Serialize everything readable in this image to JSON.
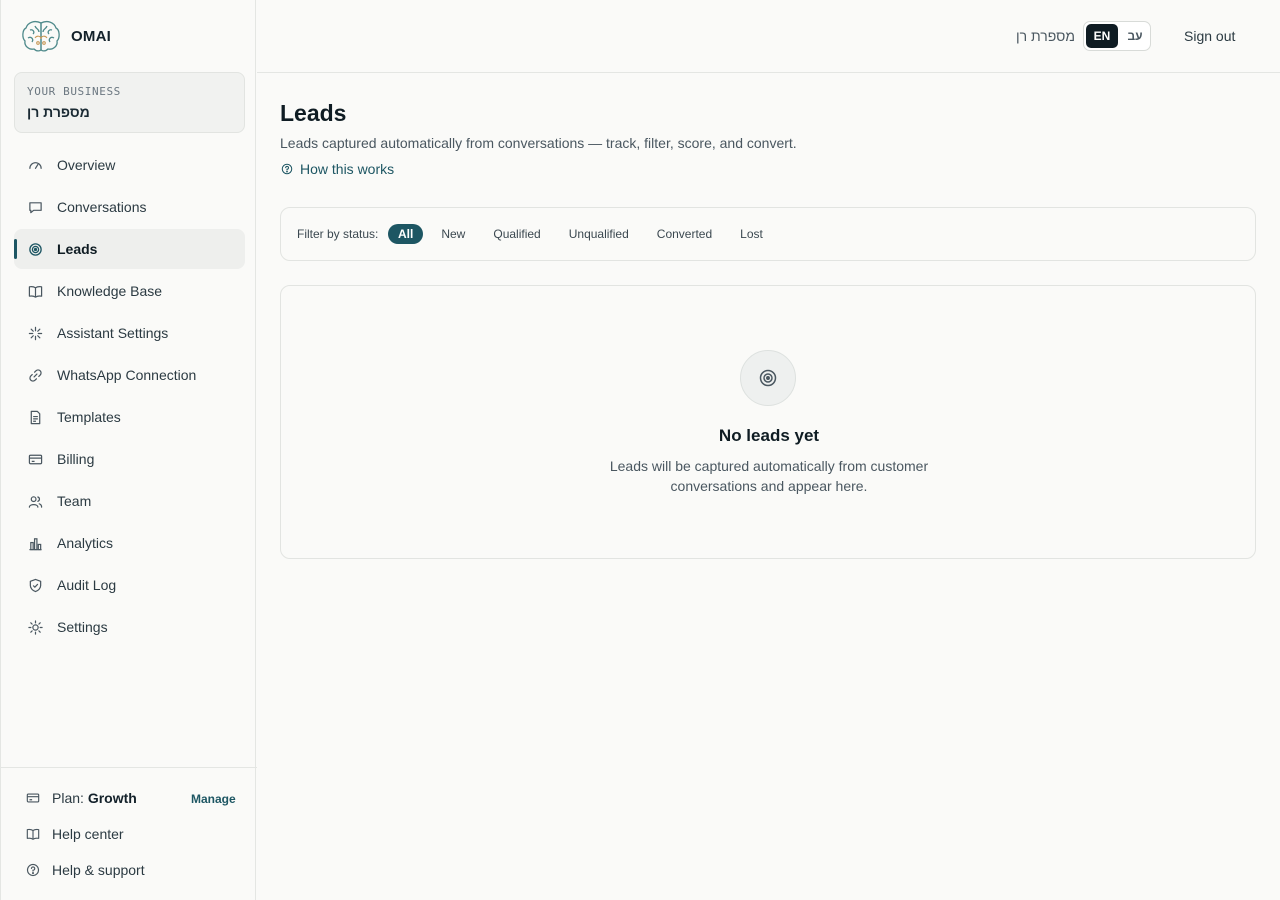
{
  "app": {
    "name": "OMAI"
  },
  "business": {
    "label": "YOUR BUSINESS",
    "name": "מספרת רן"
  },
  "sidebar": {
    "items": [
      {
        "label": "Overview",
        "icon": "gauge-icon"
      },
      {
        "label": "Conversations",
        "icon": "chat-bubble-icon"
      },
      {
        "label": "Leads",
        "icon": "target-icon",
        "active": true
      },
      {
        "label": "Knowledge Base",
        "icon": "book-open-icon"
      },
      {
        "label": "Assistant Settings",
        "icon": "sparkle-icon"
      },
      {
        "label": "WhatsApp Connection",
        "icon": "link-icon"
      },
      {
        "label": "Templates",
        "icon": "file-text-icon"
      },
      {
        "label": "Billing",
        "icon": "credit-card-icon"
      },
      {
        "label": "Team",
        "icon": "users-icon"
      },
      {
        "label": "Analytics",
        "icon": "bar-chart-icon"
      },
      {
        "label": "Audit Log",
        "icon": "shield-check-icon"
      },
      {
        "label": "Settings",
        "icon": "sun-gear-icon"
      }
    ],
    "footer": {
      "plan_prefix": "Plan:",
      "plan_name": "Growth",
      "manage_label": "Manage",
      "help_center": "Help center",
      "help_support": "Help & support"
    }
  },
  "header": {
    "business_name": "מספרת רן",
    "lang_en": "EN",
    "lang_he": "עב",
    "sign_out": "Sign out"
  },
  "main": {
    "title": "Leads",
    "subtitle": "Leads captured automatically from conversations — track, filter, score, and convert.",
    "how_link": "How this works",
    "filter": {
      "label": "Filter by status:",
      "options": [
        "All",
        "New",
        "Qualified",
        "Unqualified",
        "Converted",
        "Lost"
      ],
      "selected": "All"
    },
    "empty": {
      "title": "No leads yet",
      "text": "Leads will be captured automatically from customer conversations and appear here."
    }
  },
  "colors": {
    "accent": "#1d5663",
    "background": "#fafaf8",
    "text_primary": "#0f1c23",
    "text_secondary": "#4a5760",
    "border": "#e2e4e1"
  }
}
